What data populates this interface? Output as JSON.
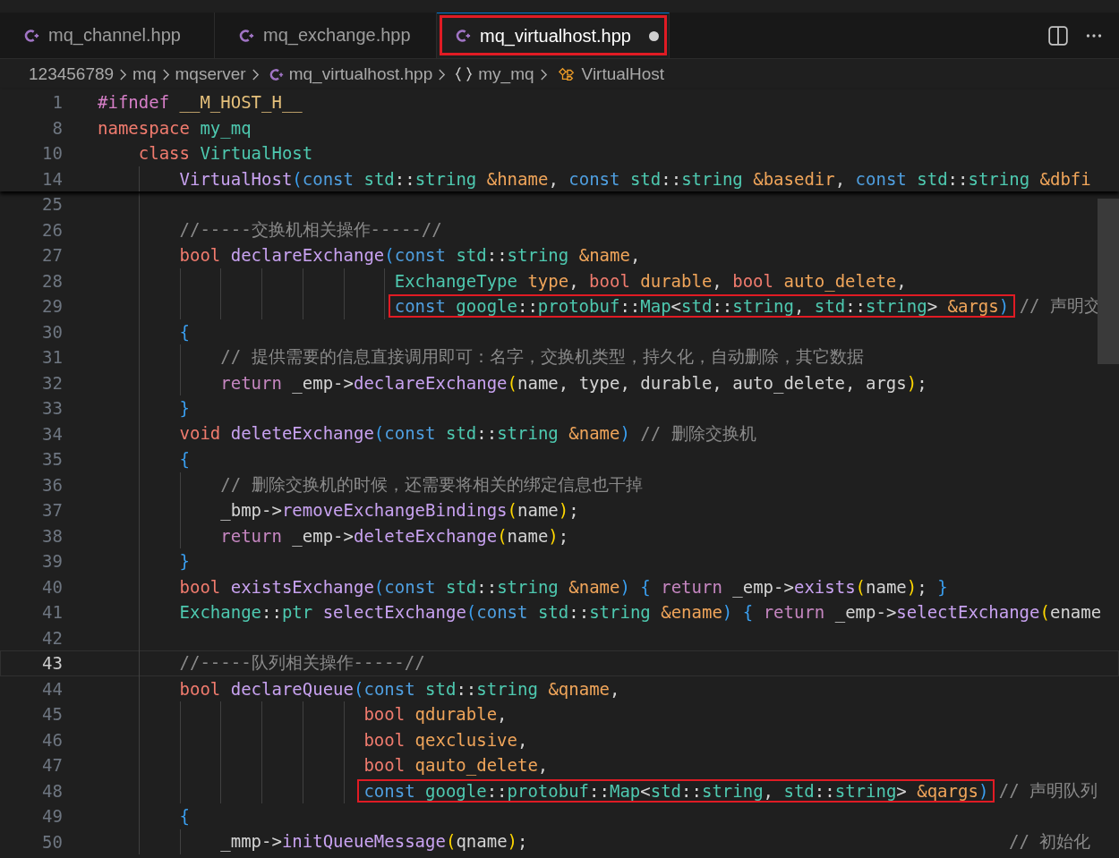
{
  "tabs": [
    {
      "label": "mq_channel.hpp",
      "selected": false,
      "modified": false,
      "annotated": false
    },
    {
      "label": "mq_exchange.hpp",
      "selected": false,
      "modified": false,
      "annotated": false
    },
    {
      "label": "mq_virtualhost.hpp",
      "selected": true,
      "modified": true,
      "annotated": true
    }
  ],
  "breadcrumb": [
    {
      "kind": "folder",
      "label": "123456789"
    },
    {
      "kind": "folder",
      "label": "mq"
    },
    {
      "kind": "folder",
      "label": "mqserver"
    },
    {
      "kind": "file",
      "label": "mq_virtualhost.hpp"
    },
    {
      "kind": "namespace",
      "label": "my_mq"
    },
    {
      "kind": "class",
      "label": "VirtualHost"
    }
  ],
  "sticky_lines": [
    {
      "number": "1",
      "kind": "top",
      "current": false,
      "tokens": [
        {
          "kind": "directive",
          "text": "#ifndef "
        },
        {
          "kind": "macro",
          "text": "__M_HOST_H__"
        }
      ]
    },
    {
      "number": "8",
      "kind": "top",
      "current": false,
      "tokens": [
        {
          "kind": "keyword",
          "text": "namespace "
        },
        {
          "kind": "type",
          "text": "my_mq"
        }
      ]
    },
    {
      "number": "10",
      "kind": "class",
      "current": false,
      "tokens": [
        {
          "kind": "keyword",
          "text": "class "
        },
        {
          "kind": "type",
          "text": "VirtualHost"
        }
      ]
    },
    {
      "number": "14",
      "kind": "member",
      "current": false,
      "tokens": [
        {
          "kind": "function",
          "text": "VirtualHost"
        },
        {
          "kind": "bracket3",
          "text": "("
        },
        {
          "kind": "storage",
          "text": "const "
        },
        {
          "kind": "type",
          "text": "std"
        },
        {
          "kind": "plain",
          "text": "::"
        },
        {
          "kind": "type",
          "text": "string "
        },
        {
          "kind": "param",
          "text": "&hname"
        },
        {
          "kind": "plain",
          "text": ", "
        },
        {
          "kind": "storage",
          "text": "const "
        },
        {
          "kind": "type",
          "text": "std"
        },
        {
          "kind": "plain",
          "text": "::"
        },
        {
          "kind": "type",
          "text": "string "
        },
        {
          "kind": "param",
          "text": "&basedir"
        },
        {
          "kind": "plain",
          "text": ", "
        },
        {
          "kind": "storage",
          "text": "const "
        },
        {
          "kind": "type",
          "text": "std"
        },
        {
          "kind": "plain",
          "text": "::"
        },
        {
          "kind": "type",
          "text": "string "
        },
        {
          "kind": "param",
          "text": "&dbfi"
        }
      ]
    }
  ],
  "lines": [
    {
      "number": "25",
      "kind": "blank",
      "current": false
    },
    {
      "number": "26",
      "kind": "member",
      "current": false,
      "tokens": [
        {
          "kind": "comment",
          "text": "//-----交换机相关操作-----//"
        }
      ]
    },
    {
      "number": "27",
      "kind": "member",
      "current": false,
      "tokens": [
        {
          "kind": "keyword",
          "text": "bool "
        },
        {
          "kind": "function",
          "text": "declareExchange"
        },
        {
          "kind": "bracket3",
          "text": "("
        },
        {
          "kind": "storage",
          "text": "const "
        },
        {
          "kind": "type",
          "text": "std"
        },
        {
          "kind": "plain",
          "text": "::"
        },
        {
          "kind": "type",
          "text": "string "
        },
        {
          "kind": "param",
          "text": "&name"
        },
        {
          "kind": "plain",
          "text": ","
        }
      ]
    },
    {
      "number": "28",
      "kind": "continuation",
      "current": false,
      "tokens": [
        {
          "kind": "type",
          "text": "ExchangeType "
        },
        {
          "kind": "param",
          "text": "type"
        },
        {
          "kind": "plain",
          "text": ", "
        },
        {
          "kind": "keyword",
          "text": "bool "
        },
        {
          "kind": "param",
          "text": "durable"
        },
        {
          "kind": "plain",
          "text": ", "
        },
        {
          "kind": "keyword",
          "text": "bool "
        },
        {
          "kind": "param",
          "text": "auto_delete"
        },
        {
          "kind": "plain",
          "text": ","
        }
      ]
    },
    {
      "number": "29",
      "kind": "continuation",
      "current": false,
      "tokens": [
        {
          "kind": "box",
          "tokens": [
            {
              "kind": "storage",
              "text": "const "
            },
            {
              "kind": "type",
              "text": "google"
            },
            {
              "kind": "plain",
              "text": "::"
            },
            {
              "kind": "type",
              "text": "protobuf"
            },
            {
              "kind": "plain",
              "text": "::"
            },
            {
              "kind": "type",
              "text": "Map"
            },
            {
              "kind": "plain",
              "text": "<"
            },
            {
              "kind": "type",
              "text": "std"
            },
            {
              "kind": "plain",
              "text": "::"
            },
            {
              "kind": "type",
              "text": "string"
            },
            {
              "kind": "plain",
              "text": ", "
            },
            {
              "kind": "type",
              "text": "std"
            },
            {
              "kind": "plain",
              "text": "::"
            },
            {
              "kind": "type",
              "text": "string"
            },
            {
              "kind": "plain",
              "text": "> "
            },
            {
              "kind": "param",
              "text": "&args"
            },
            {
              "kind": "bracket3",
              "text": ")"
            }
          ]
        },
        {
          "kind": "comment",
          "text": " // 声明交"
        }
      ]
    },
    {
      "number": "30",
      "kind": "member",
      "current": false,
      "tokens": [
        {
          "kind": "bracket3",
          "text": "{"
        }
      ]
    },
    {
      "number": "31",
      "kind": "statement",
      "current": false,
      "tokens": [
        {
          "kind": "comment",
          "text": "// 提供需要的信息直接调用即可：名字，交换机类型，持久化，自动删除，其它数据"
        }
      ]
    },
    {
      "number": "32",
      "kind": "statement",
      "current": false,
      "tokens": [
        {
          "kind": "control",
          "text": "return "
        },
        {
          "kind": "plain",
          "text": "_emp->"
        },
        {
          "kind": "function",
          "text": "declareExchange"
        },
        {
          "kind": "bracket1",
          "text": "("
        },
        {
          "kind": "plain",
          "text": "name, type, durable, auto_delete, args"
        },
        {
          "kind": "bracket1",
          "text": ")"
        },
        {
          "kind": "plain",
          "text": ";"
        }
      ]
    },
    {
      "number": "33",
      "kind": "member",
      "current": false,
      "tokens": [
        {
          "kind": "bracket3",
          "text": "}"
        }
      ]
    },
    {
      "number": "34",
      "kind": "member",
      "current": false,
      "tokens": [
        {
          "kind": "keyword",
          "text": "void "
        },
        {
          "kind": "function",
          "text": "deleteExchange"
        },
        {
          "kind": "bracket3",
          "text": "("
        },
        {
          "kind": "storage",
          "text": "const "
        },
        {
          "kind": "type",
          "text": "std"
        },
        {
          "kind": "plain",
          "text": "::"
        },
        {
          "kind": "type",
          "text": "string "
        },
        {
          "kind": "param",
          "text": "&name"
        },
        {
          "kind": "bracket3",
          "text": ")"
        },
        {
          "kind": "comment",
          "text": " // 删除交换机"
        }
      ]
    },
    {
      "number": "35",
      "kind": "member",
      "current": false,
      "tokens": [
        {
          "kind": "bracket3",
          "text": "{"
        }
      ]
    },
    {
      "number": "36",
      "kind": "statement",
      "current": false,
      "tokens": [
        {
          "kind": "comment",
          "text": "// 删除交换机的时候，还需要将相关的绑定信息也干掉"
        }
      ]
    },
    {
      "number": "37",
      "kind": "statement",
      "current": false,
      "tokens": [
        {
          "kind": "plain",
          "text": "_bmp->"
        },
        {
          "kind": "function",
          "text": "removeExchangeBindings"
        },
        {
          "kind": "bracket1",
          "text": "("
        },
        {
          "kind": "plain",
          "text": "name"
        },
        {
          "kind": "bracket1",
          "text": ")"
        },
        {
          "kind": "plain",
          "text": ";"
        }
      ]
    },
    {
      "number": "38",
      "kind": "statement",
      "current": false,
      "tokens": [
        {
          "kind": "control",
          "text": "return "
        },
        {
          "kind": "plain",
          "text": "_emp->"
        },
        {
          "kind": "function",
          "text": "deleteExchange"
        },
        {
          "kind": "bracket1",
          "text": "("
        },
        {
          "kind": "plain",
          "text": "name"
        },
        {
          "kind": "bracket1",
          "text": ")"
        },
        {
          "kind": "plain",
          "text": ";"
        }
      ]
    },
    {
      "number": "39",
      "kind": "member",
      "current": false,
      "tokens": [
        {
          "kind": "bracket3",
          "text": "}"
        }
      ]
    },
    {
      "number": "40",
      "kind": "member",
      "current": false,
      "tokens": [
        {
          "kind": "keyword",
          "text": "bool "
        },
        {
          "kind": "function",
          "text": "existsExchange"
        },
        {
          "kind": "bracket3",
          "text": "("
        },
        {
          "kind": "storage",
          "text": "const "
        },
        {
          "kind": "type",
          "text": "std"
        },
        {
          "kind": "plain",
          "text": "::"
        },
        {
          "kind": "type",
          "text": "string "
        },
        {
          "kind": "param",
          "text": "&name"
        },
        {
          "kind": "bracket3",
          "text": ") {"
        },
        {
          "kind": "control",
          "text": " return "
        },
        {
          "kind": "plain",
          "text": "_emp->"
        },
        {
          "kind": "function",
          "text": "exists"
        },
        {
          "kind": "bracket1",
          "text": "("
        },
        {
          "kind": "plain",
          "text": "name"
        },
        {
          "kind": "bracket1",
          "text": ")"
        },
        {
          "kind": "plain",
          "text": ";"
        },
        {
          "kind": "bracket3",
          "text": " }"
        }
      ]
    },
    {
      "number": "41",
      "kind": "member",
      "current": false,
      "tokens": [
        {
          "kind": "type",
          "text": "Exchange"
        },
        {
          "kind": "plain",
          "text": "::"
        },
        {
          "kind": "type",
          "text": "ptr "
        },
        {
          "kind": "function",
          "text": "selectExchange"
        },
        {
          "kind": "bracket3",
          "text": "("
        },
        {
          "kind": "storage",
          "text": "const "
        },
        {
          "kind": "type",
          "text": "std"
        },
        {
          "kind": "plain",
          "text": "::"
        },
        {
          "kind": "type",
          "text": "string "
        },
        {
          "kind": "param",
          "text": "&ename"
        },
        {
          "kind": "bracket3",
          "text": ") {"
        },
        {
          "kind": "control",
          "text": " return "
        },
        {
          "kind": "plain",
          "text": "_emp->"
        },
        {
          "kind": "function",
          "text": "selectExchange"
        },
        {
          "kind": "bracket1",
          "text": "("
        },
        {
          "kind": "plain",
          "text": "ename"
        }
      ]
    },
    {
      "number": "42",
      "kind": "blank",
      "current": false
    },
    {
      "number": "43",
      "kind": "member",
      "current": true,
      "tokens": [
        {
          "kind": "comment",
          "text": "//-----队列相关操作-----//"
        }
      ]
    },
    {
      "number": "44",
      "kind": "member",
      "current": false,
      "tokens": [
        {
          "kind": "keyword",
          "text": "bool "
        },
        {
          "kind": "function",
          "text": "declareQueue"
        },
        {
          "kind": "bracket3",
          "text": "("
        },
        {
          "kind": "storage",
          "text": "const "
        },
        {
          "kind": "type",
          "text": "std"
        },
        {
          "kind": "plain",
          "text": "::"
        },
        {
          "kind": "type",
          "text": "string "
        },
        {
          "kind": "param",
          "text": "&qname"
        },
        {
          "kind": "plain",
          "text": ","
        }
      ]
    },
    {
      "number": "45",
      "kind": "continuation",
      "current": false,
      "tokens": [
        {
          "kind": "keyword",
          "text": "bool "
        },
        {
          "kind": "param",
          "text": "qdurable"
        },
        {
          "kind": "plain",
          "text": ","
        }
      ]
    },
    {
      "number": "46",
      "kind": "continuation",
      "current": false,
      "tokens": [
        {
          "kind": "keyword",
          "text": "bool "
        },
        {
          "kind": "param",
          "text": "qexclusive"
        },
        {
          "kind": "plain",
          "text": ","
        }
      ]
    },
    {
      "number": "47",
      "kind": "continuation",
      "current": false,
      "tokens": [
        {
          "kind": "keyword",
          "text": "bool "
        },
        {
          "kind": "param",
          "text": "qauto_delete"
        },
        {
          "kind": "plain",
          "text": ","
        }
      ]
    },
    {
      "number": "48",
      "kind": "continuation",
      "current": false,
      "tokens": [
        {
          "kind": "box",
          "tokens": [
            {
              "kind": "storage",
              "text": "const "
            },
            {
              "kind": "type",
              "text": "google"
            },
            {
              "kind": "plain",
              "text": "::"
            },
            {
              "kind": "type",
              "text": "protobuf"
            },
            {
              "kind": "plain",
              "text": "::"
            },
            {
              "kind": "type",
              "text": "Map"
            },
            {
              "kind": "plain",
              "text": "<"
            },
            {
              "kind": "type",
              "text": "std"
            },
            {
              "kind": "plain",
              "text": "::"
            },
            {
              "kind": "type",
              "text": "string"
            },
            {
              "kind": "plain",
              "text": ", "
            },
            {
              "kind": "type",
              "text": "std"
            },
            {
              "kind": "plain",
              "text": "::"
            },
            {
              "kind": "type",
              "text": "string"
            },
            {
              "kind": "plain",
              "text": "> "
            },
            {
              "kind": "param",
              "text": "&qargs"
            },
            {
              "kind": "bracket3",
              "text": ")"
            }
          ]
        },
        {
          "kind": "comment",
          "text": " // 声明队列"
        }
      ]
    },
    {
      "number": "49",
      "kind": "member",
      "current": false,
      "tokens": [
        {
          "kind": "bracket3",
          "text": "{"
        }
      ]
    },
    {
      "number": "50",
      "kind": "statement",
      "current": false,
      "tokens": [
        {
          "kind": "plain",
          "text": "_mmp->"
        },
        {
          "kind": "function",
          "text": "initQueueMessage"
        },
        {
          "kind": "bracket1",
          "text": "("
        },
        {
          "kind": "plain",
          "text": "qname"
        },
        {
          "kind": "bracket1",
          "text": ")"
        },
        {
          "kind": "plain",
          "text": ";"
        },
        {
          "kind": "aside_comment",
          "text": "// 初始化"
        }
      ]
    }
  ]
}
